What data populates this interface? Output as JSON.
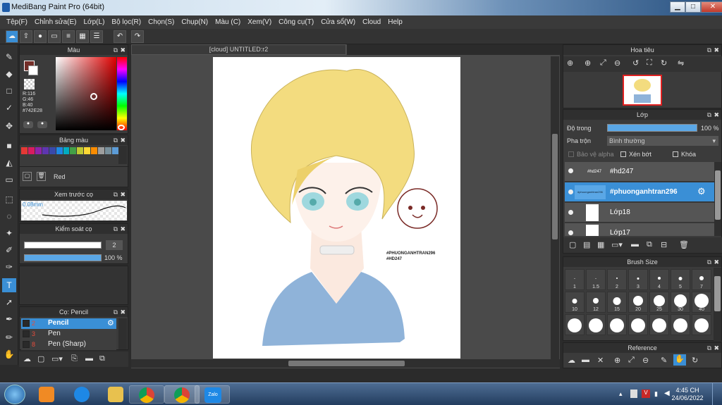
{
  "window": {
    "title": "MediBang Paint Pro (64bit)",
    "minimize": "▁",
    "maximize": "□",
    "close": "✕"
  },
  "menu": [
    "Tệp(F)",
    "Chỉnh sửa(E)",
    "Lớp(L)",
    "Bộ lọc(R)",
    "Chọn(S)",
    "Chụp(N)",
    "Màu (C)",
    "Xem(V)",
    "Công cụ(T)",
    "Cửa sổ(W)",
    "Cloud",
    "Help"
  ],
  "toolbar_icons": [
    "cloud-icon",
    "share-icon",
    "comment-icon",
    "chat-icon",
    "document-icon",
    "grid-icon",
    "list-icon",
    "undo-icon",
    "redo-icon"
  ],
  "color_panel": {
    "title": "Màu",
    "r": "R:116",
    "g": "G:46",
    "b": "B:40",
    "hex": "#742E28",
    "accent": "#742E28"
  },
  "palette_panel": {
    "title": "Bảng màu",
    "label": "Red",
    "swatches": [
      "#e53935",
      "#d81b60",
      "#8e24aa",
      "#5e35b1",
      "#3949ab",
      "#1e88e5",
      "#00acc1",
      "#43a047",
      "#c0ca33",
      "#fdd835",
      "#fb8c00",
      "#9e9e9e",
      "#78909c",
      "#5c9bd6"
    ]
  },
  "preview_panel": {
    "title": "Xem trước cọ",
    "size": "0.08mm"
  },
  "control_panel": {
    "title": "Kiểm soát cọ",
    "size": "2",
    "opacity": "100 %"
  },
  "brush_panel": {
    "title": "Cọ: Pencil",
    "brushes": [
      {
        "num": "2",
        "name": "Pencil"
      },
      {
        "num": "3",
        "name": "Pen"
      },
      {
        "num": "8",
        "name": "Pen (Sharp)"
      }
    ]
  },
  "document": {
    "tab": "[cloud] UNTITLED:r2"
  },
  "artwork": {
    "watermark1": "#PHUONGANHTRAN296",
    "watermark2": "#HD247"
  },
  "navigator": {
    "title": "Hoa tiêu"
  },
  "layer_panel": {
    "title": "Lớp",
    "opacity_label": "Độ trong",
    "opacity_value": "100 %",
    "blend_label": "Pha trộn",
    "blend_value": "Bình thường",
    "protect_alpha": "Bảo vệ alpha",
    "clipping": "Xén bớt",
    "lock": "Khóa",
    "layers": [
      {
        "name": "#hd247",
        "thumb": "#hd247"
      },
      {
        "name": "#phuonganhtran296",
        "thumb": "#phuonganhtran296"
      },
      {
        "name": "Lớp18",
        "thumb": ""
      },
      {
        "name": "Lớp17",
        "thumb": ""
      }
    ]
  },
  "brush_size_panel": {
    "title": "Brush Size",
    "sizes": [
      "1",
      "1.5",
      "2",
      "3",
      "4",
      "5",
      "7",
      "10",
      "12",
      "15",
      "20",
      "25",
      "30",
      "40"
    ]
  },
  "reference_panel": {
    "title": "Reference"
  },
  "taskbar": {
    "time": "4:45 CH",
    "date": "24/06/2022",
    "apps": [
      "windows-start",
      "media-player",
      "internet-explorer",
      "file-explorer",
      "chrome-alt",
      "chrome",
      "zalo"
    ],
    "zalo_label": "Zalo"
  }
}
